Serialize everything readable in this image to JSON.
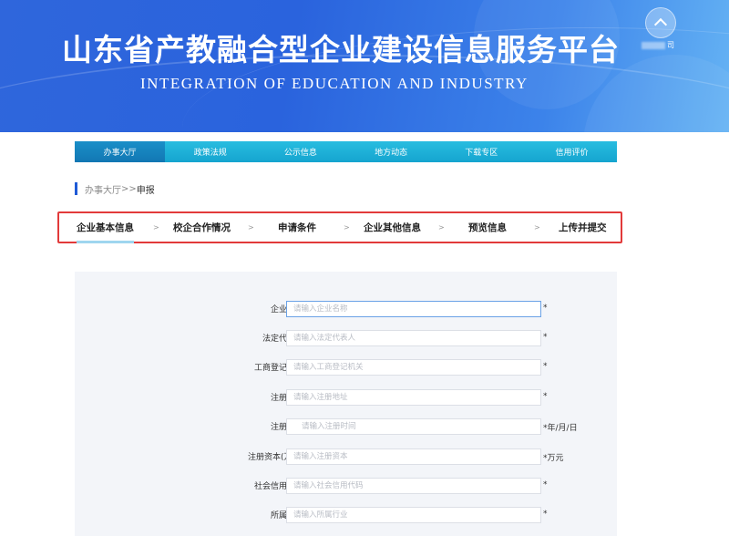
{
  "header": {
    "title_cn": "山东省产教融合型企业建设信息服务平台",
    "title_en": "INTEGRATION OF EDUCATION AND INDUSTRY",
    "corner_text": "司"
  },
  "nav": {
    "items": [
      "办事大厅",
      "政策法规",
      "公示信息",
      "地方动态",
      "下载专区",
      "信用评价"
    ],
    "active_index": 0
  },
  "breadcrumb": {
    "parent": "办事大厅",
    "separator": ">>",
    "current": "申报"
  },
  "steps": {
    "items": [
      "企业基本信息",
      "校企合作情况",
      "申请条件",
      "企业其他信息",
      "预览信息",
      "上传并提交"
    ],
    "separator": ">",
    "active_index": 0
  },
  "form": {
    "fields": [
      {
        "label": "企业名称：",
        "placeholder": "请输入企业名称",
        "suffix": "*"
      },
      {
        "label": "法定代表人：",
        "placeholder": "请输入法定代表人",
        "suffix": "*"
      },
      {
        "label": "工商登记机关：",
        "placeholder": "请输入工商登记机关",
        "suffix": "*"
      },
      {
        "label": "注册地址：",
        "placeholder": "请输入注册地址",
        "suffix": "*"
      },
      {
        "label": "注册时间：",
        "placeholder": "请输入注册时间",
        "suffix": "*年/月/日"
      },
      {
        "label": "注册资本(万元)：",
        "placeholder": "请输入注册资本",
        "suffix": "*万元"
      },
      {
        "label": "社会信用代码：",
        "placeholder": "请输入社会信用代码",
        "suffix": "*"
      },
      {
        "label": "所属行业：",
        "placeholder": "请输入所属行业",
        "suffix": "*"
      }
    ]
  }
}
